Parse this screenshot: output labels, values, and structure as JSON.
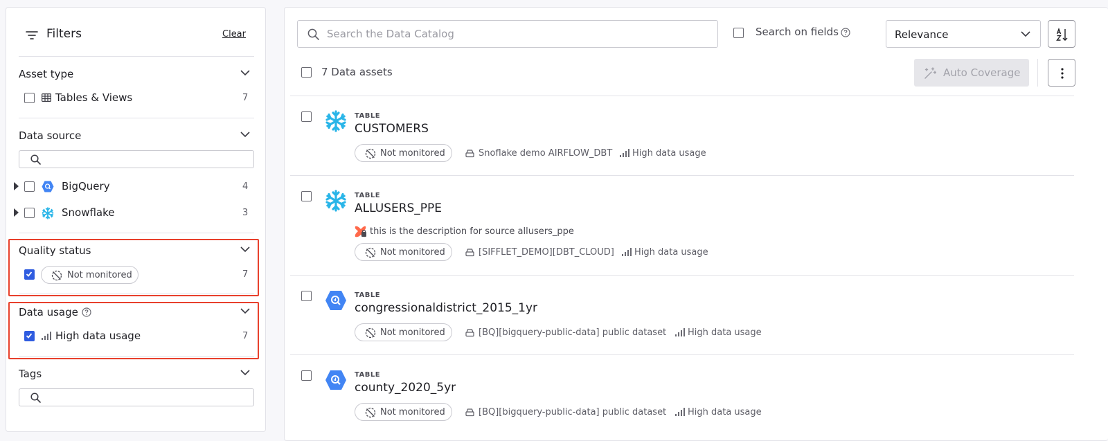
{
  "filters": {
    "title": "Filters",
    "clear_label": "Clear",
    "asset_type": {
      "title": "Asset type",
      "options": [
        {
          "label": "Tables & Views",
          "count": "7"
        }
      ]
    },
    "data_source": {
      "title": "Data source",
      "search_placeholder": "",
      "options": [
        {
          "label": "BigQuery",
          "count": "4"
        },
        {
          "label": "Snowflake",
          "count": "3"
        }
      ]
    },
    "quality_status": {
      "title": "Quality status",
      "options": [
        {
          "label": "Not monitored",
          "count": "7",
          "checked": true
        }
      ]
    },
    "data_usage": {
      "title": "Data usage",
      "options": [
        {
          "label": "High data usage",
          "count": "7",
          "checked": true
        }
      ]
    },
    "tags": {
      "title": "Tags",
      "search_placeholder": ""
    }
  },
  "toolbar": {
    "search_placeholder": "Search the Data Catalog",
    "search_on_fields_label": "Search on fields",
    "sort_selected": "Relevance",
    "select_all_label": "7 Data assets",
    "auto_coverage_label": "Auto Coverage"
  },
  "assets": [
    {
      "type": "TABLE",
      "name": "CUSTOMERS",
      "source_type": "snowflake",
      "description": "",
      "status": "Not monitored",
      "source": "Snoflake demo AIRFLOW_DBT",
      "usage": "High data usage"
    },
    {
      "type": "TABLE",
      "name": "ALLUSERS_PPE",
      "source_type": "snowflake",
      "description": "this is the description for source allusers_ppe",
      "status": "Not monitored",
      "source": "[SIFFLET_DEMO][DBT_CLOUD]",
      "usage": "High data usage"
    },
    {
      "type": "TABLE",
      "name": "congressionaldistrict_2015_1yr",
      "source_type": "bigquery",
      "description": "",
      "status": "Not monitored",
      "source": "[BQ][bigquery-public-data] public dataset",
      "usage": "High data usage"
    },
    {
      "type": "TABLE",
      "name": "county_2020_5yr",
      "source_type": "bigquery",
      "description": "",
      "status": "Not monitored",
      "source": "[BQ][bigquery-public-data] public dataset",
      "usage": "High data usage"
    }
  ],
  "colors": {
    "accent": "#2f5ce0",
    "highlight": "#e8402c",
    "snowflake": "#29b5e8",
    "bigquery": "#4285f4"
  }
}
